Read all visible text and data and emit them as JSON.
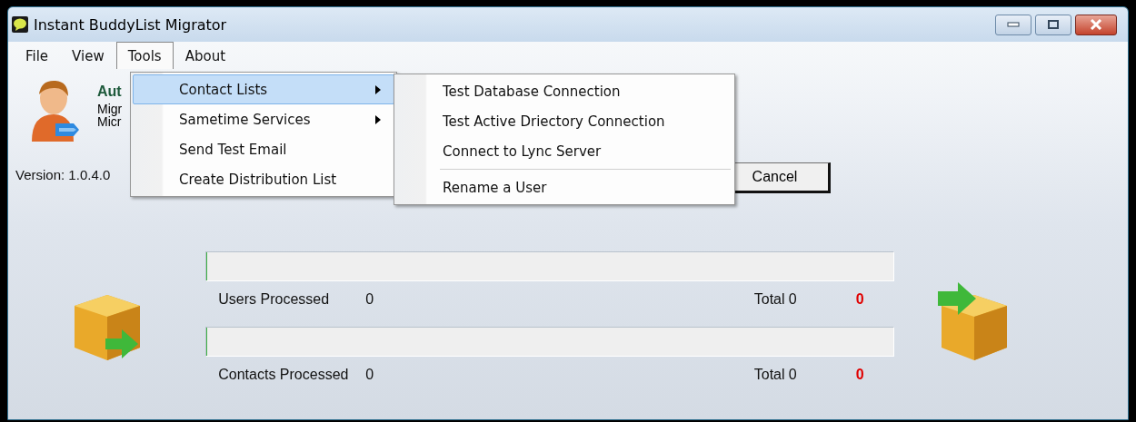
{
  "window": {
    "title": "Instant BuddyList Migrator"
  },
  "menu_bar": [
    {
      "label": "File",
      "selected": false
    },
    {
      "label": "View",
      "selected": false
    },
    {
      "label": "Tools",
      "selected": true
    },
    {
      "label": "About",
      "selected": false
    }
  ],
  "tools_menu": [
    {
      "label": "Contact Lists",
      "has_submenu": true,
      "selected": true
    },
    {
      "label": "Sametime Services",
      "has_submenu": true,
      "selected": false
    },
    {
      "label": "Send Test Email",
      "has_submenu": false,
      "selected": false
    },
    {
      "label": "Create Distribution List",
      "has_submenu": false,
      "selected": false
    }
  ],
  "contact_lists_submenu": [
    {
      "label": "Test Database Connection",
      "separator_before": false
    },
    {
      "label": "Test Active Driectory Connection",
      "separator_before": false
    },
    {
      "label": "Connect to Lync Server",
      "separator_before": false
    },
    {
      "label": "Rename a User",
      "separator_before": true
    }
  ],
  "header": {
    "title": "Aut",
    "lines": [
      "Migr",
      "Micr"
    ]
  },
  "version": "Version: 1.0.4.0",
  "cancel_button": "Cancel",
  "progress": [
    {
      "label": "Users Processed",
      "count": "0",
      "level": 0,
      "total_label": "Total",
      "total": "0",
      "failed": "0"
    },
    {
      "label": "Contacts Processed",
      "count": "0",
      "level": 0,
      "total_label": "Total",
      "total": "0",
      "failed": "0"
    }
  ]
}
